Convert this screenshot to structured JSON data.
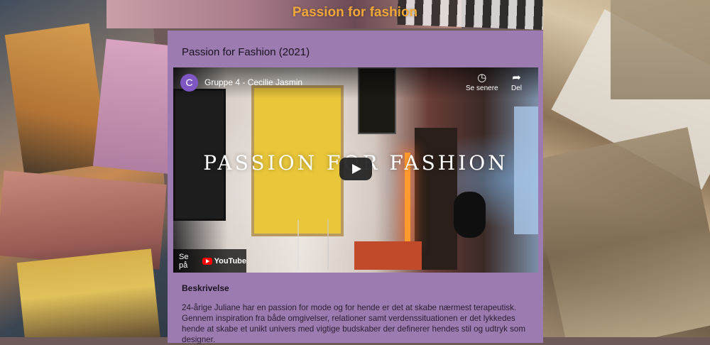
{
  "site": {
    "title": "Passion for fashion"
  },
  "project": {
    "title": "Passion for Fashion (2021)"
  },
  "video": {
    "channel_initial": "C",
    "channel_name": "Gruppe 4 - Cecilie Jasmin",
    "watch_later_label": "Se senere",
    "share_label": "Del",
    "headline": "PASSION FOR FASHION",
    "watch_on_label": "Se på",
    "youtube_label": "YouTube"
  },
  "description": {
    "heading": "Beskrivelse",
    "text": "24-årige Juliane har en passion for mode og for hende er det at skabe nærmest terapeutisk. Gennem inspiration fra både omgivelser, relationer samt verdenssituationen er det lykkedes hende at skabe et unikt univers med vigtige budskaber der definerer hendes stil og udtryk som designer."
  },
  "colors": {
    "accent": "#f0a73a",
    "panel": "#9c7bb0",
    "avatar": "#7e57c2"
  }
}
